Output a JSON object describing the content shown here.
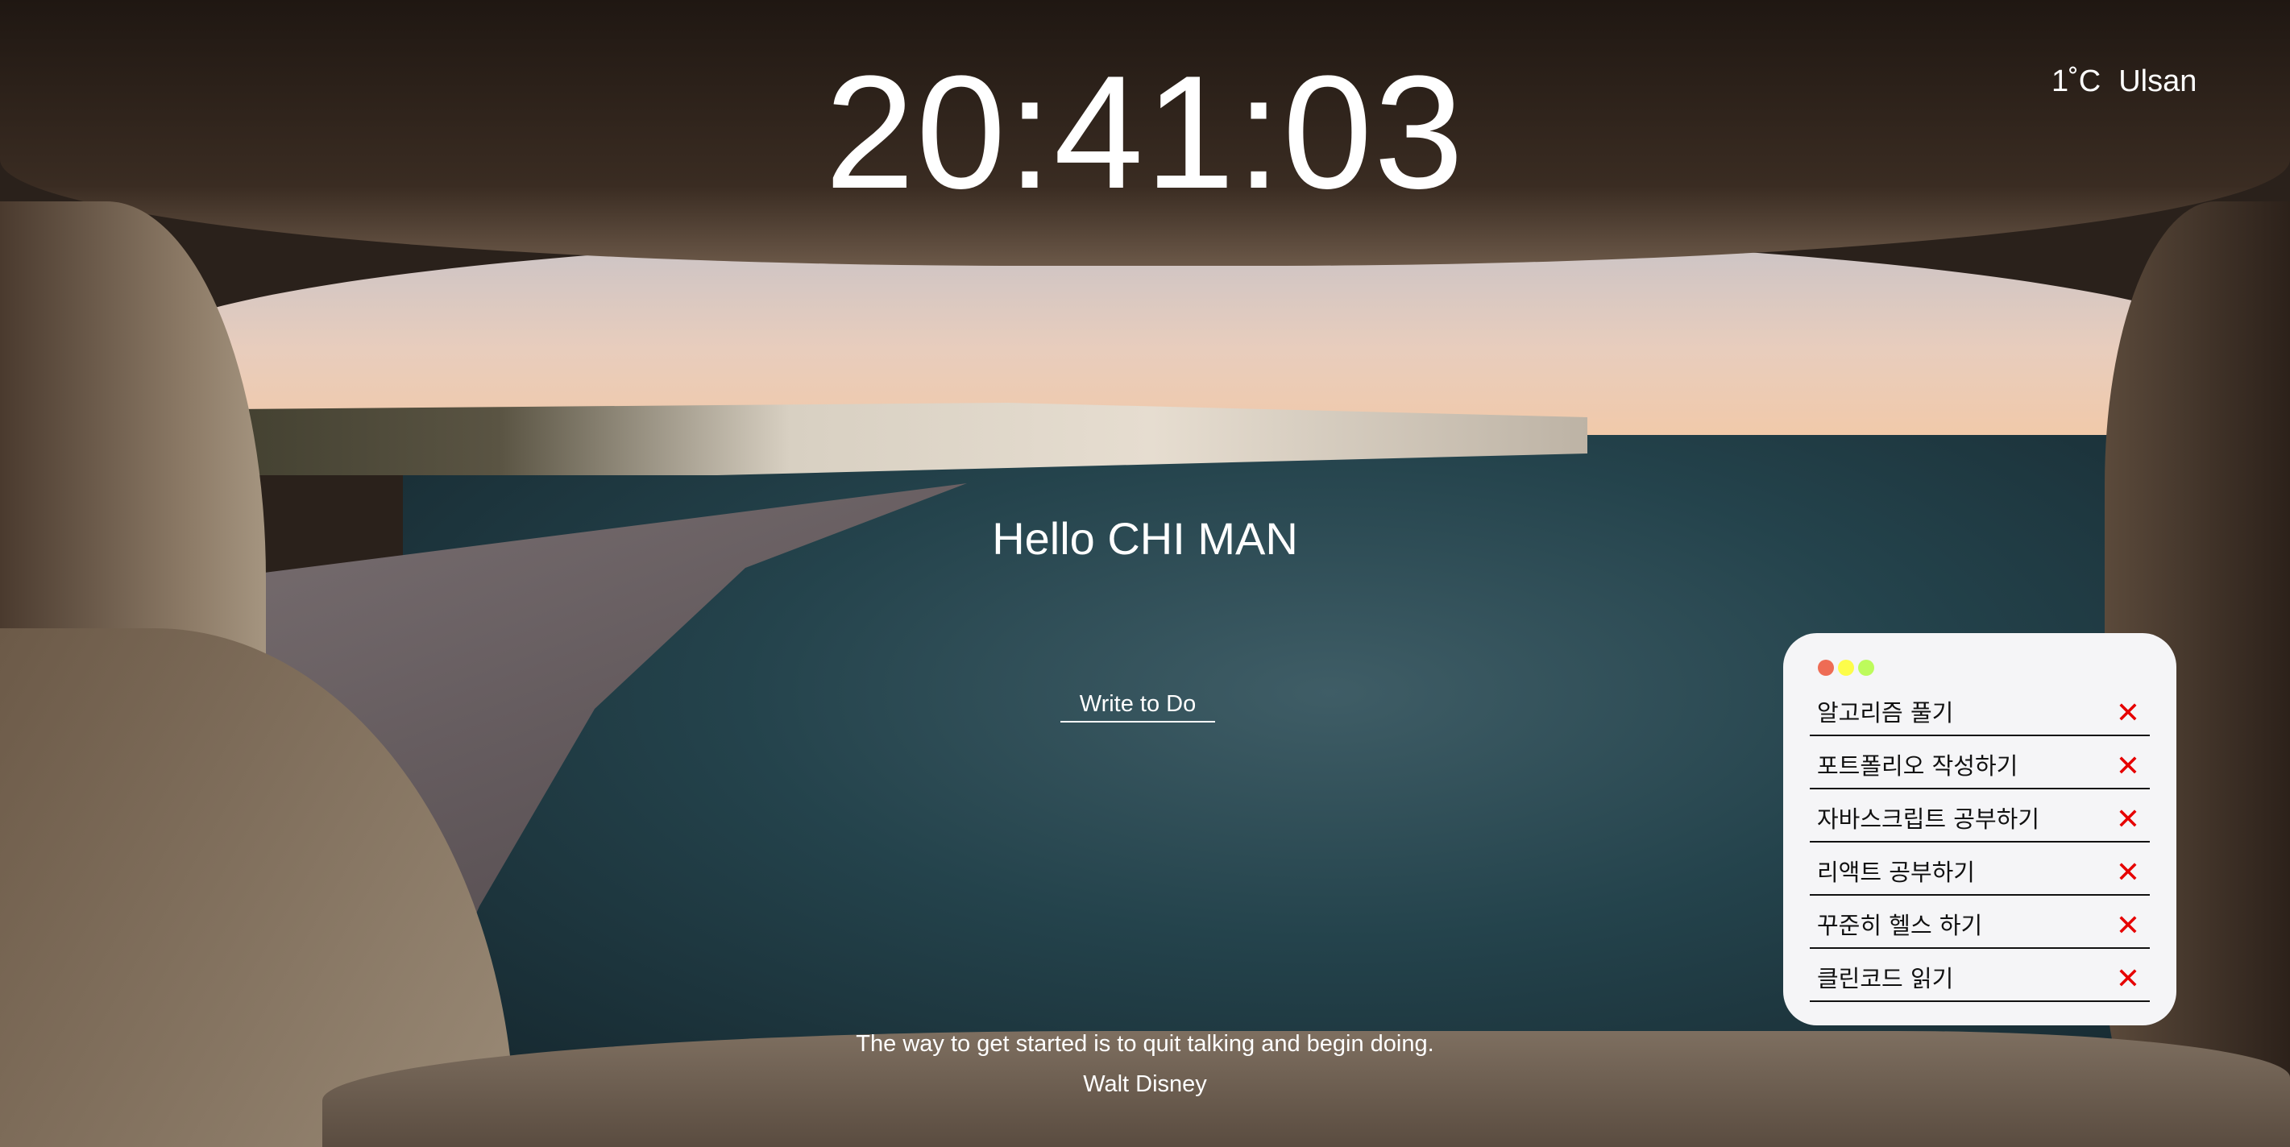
{
  "clock": {
    "time": "20:41:03"
  },
  "weather": {
    "temperature": "1˚C",
    "city": "Ulsan"
  },
  "greeting": "Hello CHI MAN",
  "todo_input": {
    "placeholder": "Write to Do",
    "value": ""
  },
  "quote": {
    "text": "The way to get started is to quit talking and begin doing.",
    "author": "Walt Disney"
  },
  "todo_panel": {
    "dot_colors": [
      "#ee6c55",
      "#fdfd4a",
      "#bdfb5c"
    ],
    "delete_icon": "✕",
    "delete_color": "#e60000",
    "items": [
      {
        "text": "알고리즘 풀기"
      },
      {
        "text": "포트폴리오 작성하기"
      },
      {
        "text": "자바스크립트 공부하기"
      },
      {
        "text": "리액트 공부하기"
      },
      {
        "text": "꾸준히 헬스 하기"
      },
      {
        "text": "클린코드 읽기"
      }
    ]
  }
}
